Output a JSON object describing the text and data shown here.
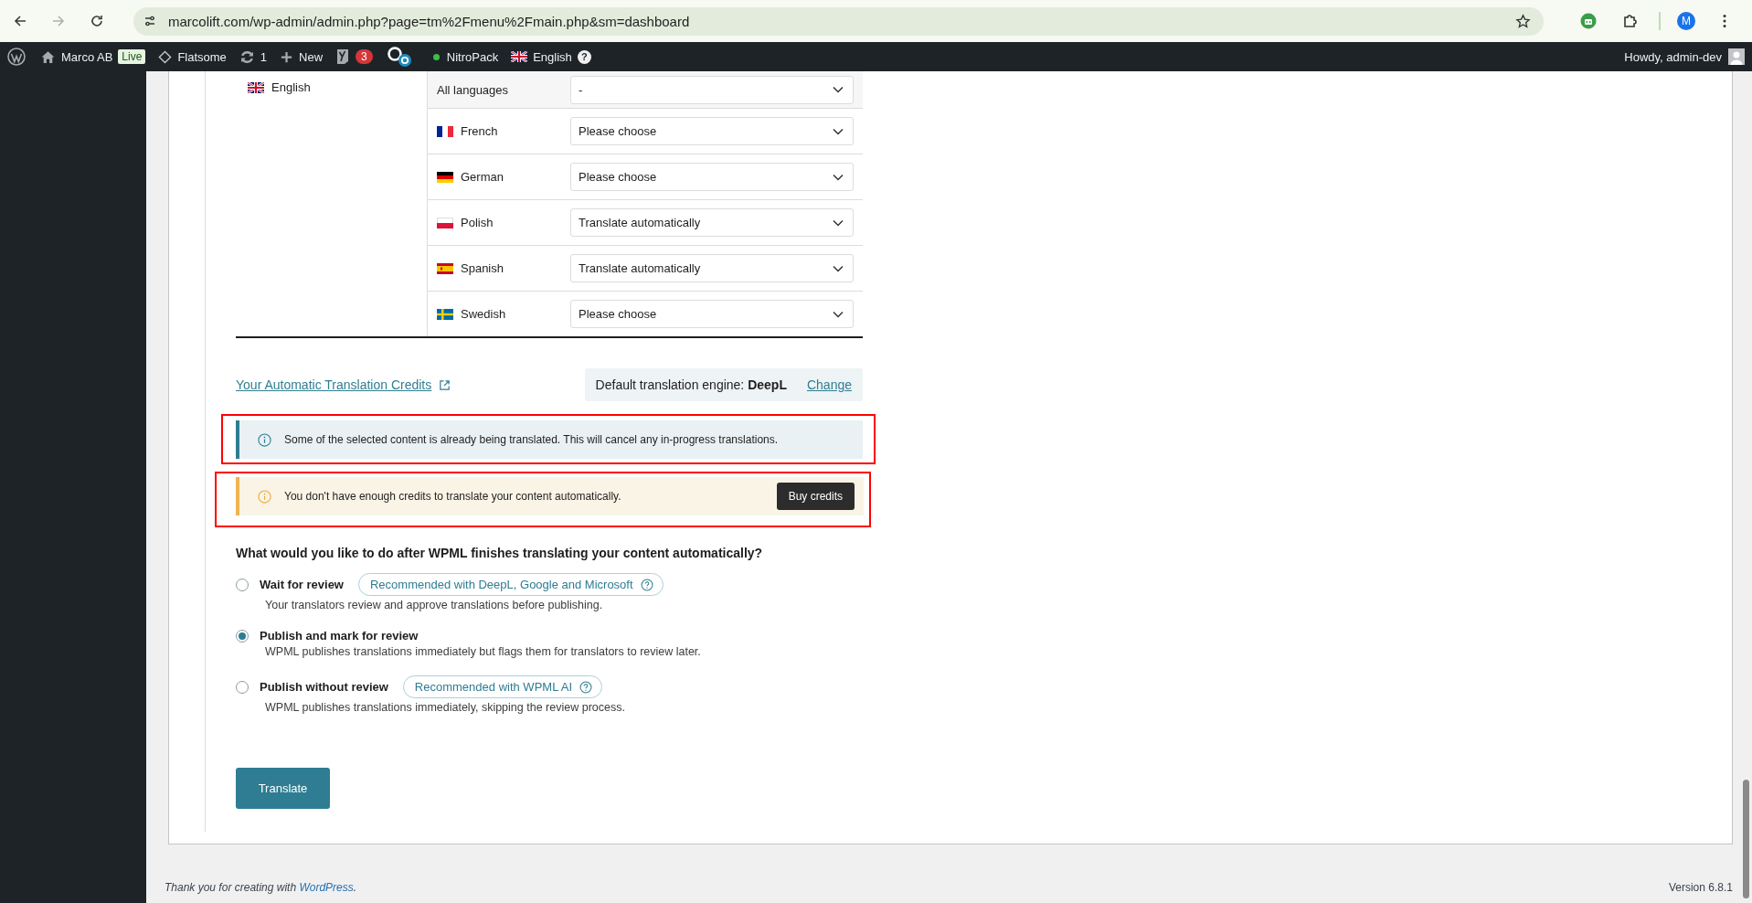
{
  "browser": {
    "url": "marcolift.com/wp-admin/admin.php?page=tm%2Fmenu%2Fmain.php&sm=dashboard",
    "forward_disabled": true,
    "profile_initial": "M"
  },
  "admin_bar": {
    "site": "Marco AB",
    "live_badge": "Live",
    "theme": "Flatsome",
    "updates": "1",
    "new": "New",
    "seo_count": "3",
    "nitropack": "NitroPack",
    "language": "English",
    "help": "?",
    "greeting": "Howdy, admin-dev"
  },
  "source_language": {
    "name": "English",
    "kind": "gb"
  },
  "all_languages": {
    "label": "All languages",
    "value": "-"
  },
  "languages": [
    {
      "name": "French",
      "kind": "fr",
      "value": "Please choose"
    },
    {
      "name": "German",
      "kind": "de",
      "value": "Please choose"
    },
    {
      "name": "Polish",
      "kind": "pl",
      "value": "Translate automatically"
    },
    {
      "name": "Spanish",
      "kind": "es",
      "value": "Translate automatically"
    },
    {
      "name": "Swedish",
      "kind": "se",
      "value": "Please choose"
    }
  ],
  "credits_link": "Your Automatic Translation Credits",
  "engine": {
    "label": "Default translation engine:",
    "name": "DeepL",
    "change": "Change"
  },
  "notices": [
    {
      "kind": "info",
      "text": "Some of the selected content is already being translated. This will cancel any in-progress translations.",
      "highlighted": true
    },
    {
      "kind": "warning",
      "text": "You don't have enough credits to translate your content automatically.",
      "button": "Buy credits",
      "highlighted": true
    }
  ],
  "question": "What would you like to do after WPML finishes translating your content automatically?",
  "options": [
    {
      "title": "Wait for review",
      "badge": "Recommended with DeepL, Google and Microsoft",
      "description": "Your translators review and approve translations before publishing.",
      "selected": false
    },
    {
      "title": "Publish and mark for review",
      "description": "WPML publishes translations immediately but flags them for translators to review later.",
      "selected": true
    },
    {
      "title": "Publish without review",
      "badge": "Recommended with WPML AI",
      "description": "WPML publishes translations immediately, skipping the review process.",
      "selected": false
    }
  ],
  "translate_button": "Translate",
  "footer": {
    "text": "Thank you for creating with",
    "link": "WordPress",
    "after": ".",
    "version": "Version 6.8.1"
  }
}
